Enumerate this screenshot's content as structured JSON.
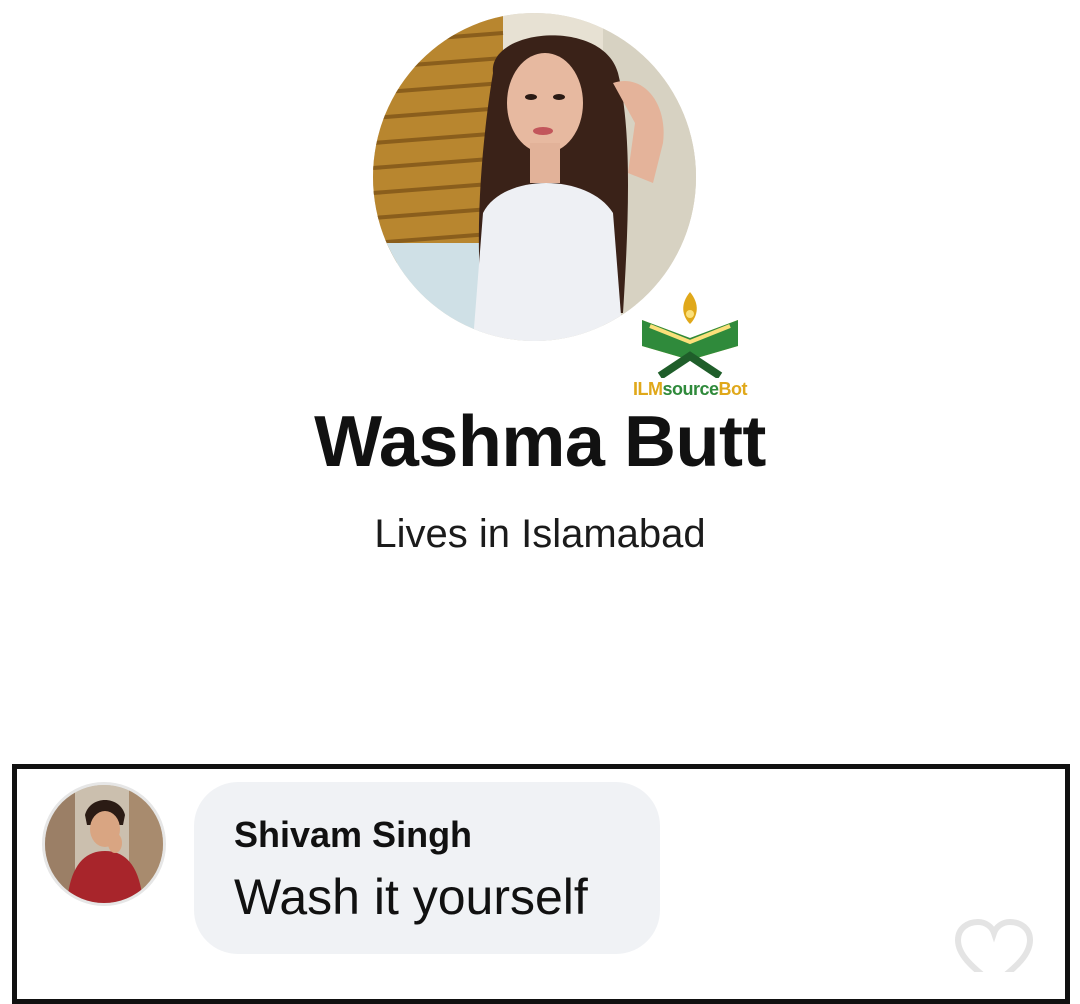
{
  "profile": {
    "name": "Washma Butt",
    "location": "Lives in Islamabad",
    "avatar_icon": "profile-photo-woman"
  },
  "watermark": {
    "text_part1": "ILM",
    "text_part2": "source",
    "text_part3": "Bot",
    "icon": "open-book-icon",
    "colors": {
      "gold": "#e0a81a",
      "green": "#2f8a3b",
      "dark_green": "#1f5e2a"
    }
  },
  "comment": {
    "author": "Shivam Singh",
    "text": "Wash it yourself",
    "avatar_icon": "profile-photo-man",
    "bubble_color": "#f0f2f5",
    "react_icon": "heart-icon"
  },
  "colors": {
    "frame_border": "#111111",
    "background": "#ffffff"
  }
}
